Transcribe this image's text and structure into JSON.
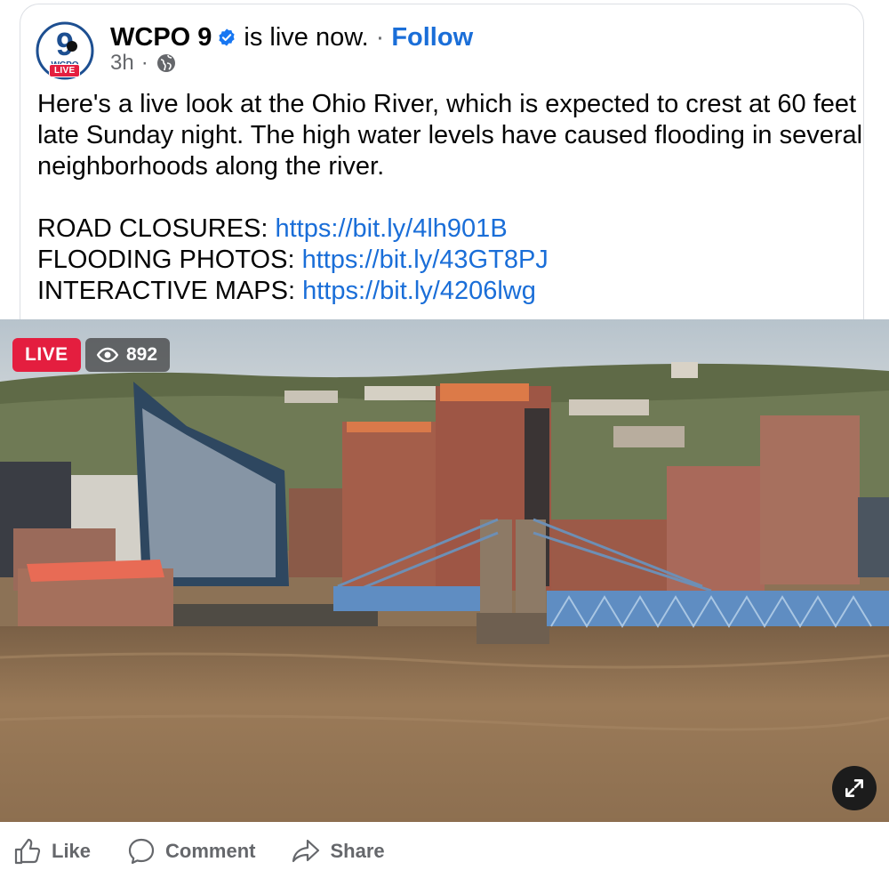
{
  "post": {
    "page_name": "WCPO 9",
    "avatar_text": "WCPO",
    "avatar_number": "9",
    "avatar_badge": "LIVE",
    "status_text": "is live now.",
    "separator": "·",
    "follow_label": "Follow",
    "time_ago": "3h",
    "time_separator": "·",
    "privacy_icon": "globe-icon",
    "verified_icon": "verified-badge-icon",
    "body_lines": [
      "Here's a live look at the Ohio River, which is expected to crest at 60 feet late Sunday night. The high water levels have caused flooding in several neighborhoods along the river."
    ],
    "links": [
      {
        "label": "ROAD CLOSURES: ",
        "url": "https://bit.ly/4lh901B"
      },
      {
        "label": "FLOODING PHOTOS: ",
        "url": "https://bit.ly/43GT8PJ"
      },
      {
        "label": "INTERACTIVE MAPS: ",
        "url": "https://bit.ly/4206lwg"
      }
    ]
  },
  "video": {
    "live_label": "LIVE",
    "viewer_count": "892",
    "viewer_icon": "eye-icon",
    "expand_icon": "expand-icon"
  },
  "actions": {
    "like_label": "Like",
    "comment_label": "Comment",
    "share_label": "Share"
  },
  "colors": {
    "accent": "#1a6ed8",
    "live_red": "#e41e3f",
    "muted": "#65676b"
  }
}
